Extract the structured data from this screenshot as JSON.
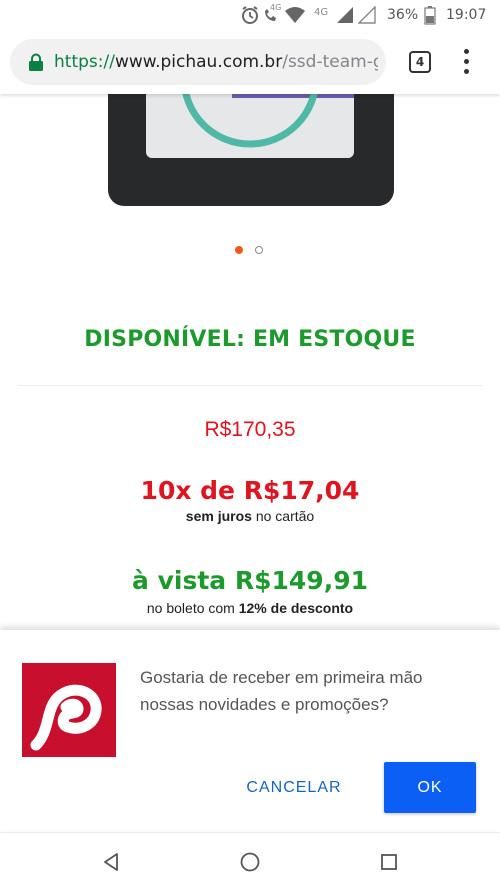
{
  "status_bar": {
    "network_label_1": "4G",
    "network_label_2": "4G",
    "battery": "36%",
    "time": "19:07"
  },
  "browser": {
    "url_scheme": "https://",
    "url_domain": "www.pichau.com.br",
    "url_path": "/ssd-team-group-l",
    "tab_count": "4"
  },
  "product": {
    "availability": "DISPONÍVEL: EM ESTOQUE",
    "price_original": "R$170,35",
    "installments": "10x de R$17,04",
    "installments_bold": "sem juros",
    "installments_rest": " no cartão",
    "cash_price": "à vista R$149,91",
    "cash_note_prefix": "no boleto com ",
    "cash_note_bold": "12% de desconto"
  },
  "carousel": {
    "slide_count": 2,
    "active_index": 0
  },
  "prompt": {
    "message": "Gostaria de receber em primeira mão nossas novidades e promoções?",
    "cancel_label": "CANCELAR",
    "ok_label": "OK"
  },
  "colors": {
    "availability_green": "#1d9a2c",
    "price_red": "#e0141e",
    "brand_red": "#c8102e",
    "ok_blue": "#0c5ff5",
    "carousel_active": "#f05a1a"
  },
  "icons": {
    "status": [
      "alarm-icon",
      "volte-call-icon",
      "wifi-icon",
      "signal-icon",
      "signal-empty-icon",
      "battery-icon"
    ],
    "browser": [
      "lock-icon",
      "tabs-icon",
      "overflow-menu-icon"
    ],
    "nav": [
      "back-icon",
      "home-icon",
      "recents-icon"
    ]
  }
}
